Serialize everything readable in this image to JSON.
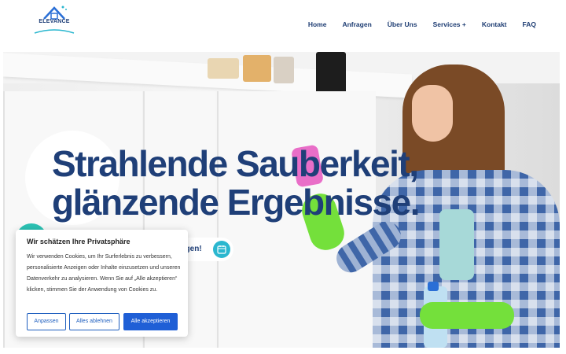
{
  "brand": {
    "logo_text": "ELEVANCE"
  },
  "nav": {
    "items": [
      "Home",
      "Anfragen",
      "Über Uns",
      "Services +",
      "Kontakt",
      "FAQ"
    ]
  },
  "hero": {
    "headline_line1": "Strahlende Sauberkeit,",
    "headline_line2": "glänzende Ergebnisse.",
    "cta_label": "agen!"
  },
  "cookie_banner": {
    "title": "Wir schätzen Ihre Privatsphäre",
    "text": "Wir verwenden Cookies, um Ihr Surferlebnis zu verbessern, personalisierte Anzeigen oder Inhalte einzusetzen und unseren Datenverkehr zu analysieren. Wenn Sie auf „Alle akzeptieren“ klicken, stimmen Sie der Anwendung von Cookies zu.",
    "buttons": {
      "customize": "Anpassen",
      "reject": "Alles ablehnen",
      "accept": "Alle akzeptieren"
    }
  },
  "colors": {
    "brand_navy": "#1f3f78",
    "accent_teal": "#2bb7cf",
    "button_blue": "#1f5fd6",
    "glove_green": "#74e03b"
  }
}
